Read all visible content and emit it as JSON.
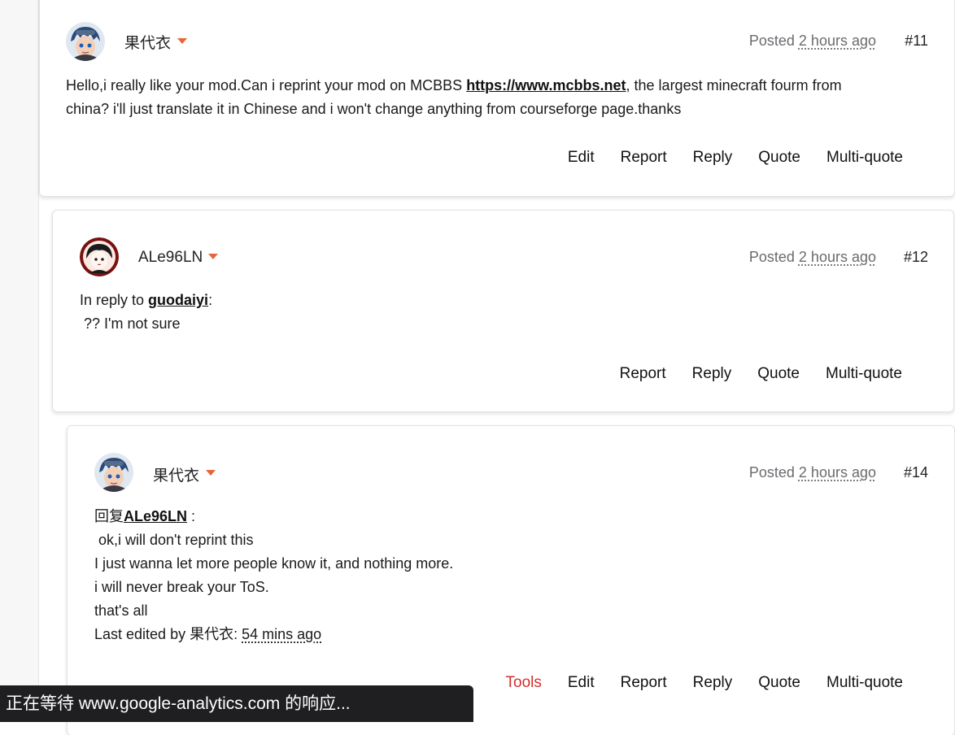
{
  "posts": [
    {
      "username": "果代衣",
      "posted_label": "Posted",
      "posted_ago": "2 hours ago",
      "number": "#11",
      "body": {
        "line1_prefix": "Hello,i really like your mod.Can i reprint your mod on MCBBS ",
        "line1_link": "https://www.mcbbs.net",
        "line1_suffix": ", the largest minecraft fourm from",
        "line2": "china? i'll just translate it in Chinese and i won't change anything from courseforge page.thanks"
      },
      "actions": [
        "Edit",
        "Report",
        "Reply",
        "Quote",
        "Multi-quote"
      ]
    },
    {
      "username": "ALe96LN",
      "posted_label": "Posted",
      "posted_ago": "2 hours ago",
      "number": "#12",
      "body": {
        "reply_prefix": "In reply to ",
        "reply_user": "guodaiyi",
        "reply_colon": ":",
        "line2": " ?? I'm not sure"
      },
      "actions": [
        "Report",
        "Reply",
        "Quote",
        "Multi-quote"
      ]
    },
    {
      "username": "果代衣",
      "posted_label": "Posted",
      "posted_ago": "2 hours ago",
      "number": "#14",
      "body": {
        "reply_prefix": "回复",
        "reply_user": "ALe96LN",
        "reply_colon": " :",
        "line2": " ok,i will don't reprint this",
        "line3": "I just wanna let more people know it, and nothing more.",
        "line4": "i will never break your ToS.",
        "line5": "that's all",
        "edited_prefix": "Last edited by 果代衣: ",
        "edited_ago": "54 mins ago"
      },
      "actions": [
        "Tools",
        "Edit",
        "Report",
        "Reply",
        "Quote",
        "Multi-quote"
      ]
    }
  ],
  "status_bar": "正在等待 www.google-analytics.com 的响应...",
  "colors": {
    "caret": "#e8643c",
    "tools_action": "#d32f2f",
    "status_bar_bg": "#1f1f22"
  },
  "icons": [
    "user-avatar-icon",
    "dropdown-caret-icon"
  ]
}
